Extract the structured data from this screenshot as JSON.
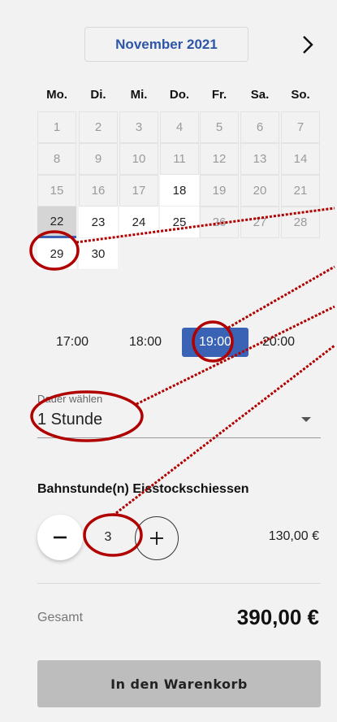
{
  "calendar": {
    "month_label": "November 2021",
    "next_icon": "chevron-right-icon",
    "weekdays": [
      "Mo.",
      "Di.",
      "Mi.",
      "Do.",
      "Fr.",
      "Sa.",
      "So."
    ],
    "weeks": [
      [
        {
          "d": "1",
          "s": "past"
        },
        {
          "d": "2",
          "s": "past"
        },
        {
          "d": "3",
          "s": "past"
        },
        {
          "d": "4",
          "s": "past"
        },
        {
          "d": "5",
          "s": "past"
        },
        {
          "d": "6",
          "s": "past"
        },
        {
          "d": "7",
          "s": "past"
        }
      ],
      [
        {
          "d": "8",
          "s": "past"
        },
        {
          "d": "9",
          "s": "past"
        },
        {
          "d": "10",
          "s": "past"
        },
        {
          "d": "11",
          "s": "past"
        },
        {
          "d": "12",
          "s": "past"
        },
        {
          "d": "13",
          "s": "past"
        },
        {
          "d": "14",
          "s": "past"
        }
      ],
      [
        {
          "d": "15",
          "s": "past"
        },
        {
          "d": "16",
          "s": "past"
        },
        {
          "d": "17",
          "s": "past"
        },
        {
          "d": "18",
          "s": "avail"
        },
        {
          "d": "19",
          "s": "past"
        },
        {
          "d": "20",
          "s": "past"
        },
        {
          "d": "21",
          "s": "past"
        }
      ],
      [
        {
          "d": "22",
          "s": "sel"
        },
        {
          "d": "23",
          "s": "avail"
        },
        {
          "d": "24",
          "s": "avail"
        },
        {
          "d": "25",
          "s": "avail"
        },
        {
          "d": "26",
          "s": "past"
        },
        {
          "d": "27",
          "s": "past"
        },
        {
          "d": "28",
          "s": "past"
        }
      ],
      [
        {
          "d": "29",
          "s": "avail"
        },
        {
          "d": "30",
          "s": "avail"
        }
      ]
    ]
  },
  "time_slots": [
    {
      "label": "17:00",
      "active": false
    },
    {
      "label": "18:00",
      "active": false
    },
    {
      "label": "19:00",
      "active": true
    },
    {
      "label": "20:00",
      "active": false
    }
  ],
  "duration": {
    "label": "Dauer wählen",
    "value": "1 Stunde"
  },
  "product": {
    "title": "Bahnstunde(n) Eisstockschiessen",
    "quantity": "3",
    "unit_price": "130,00 €"
  },
  "total": {
    "label": "Gesamt",
    "value": "390,00 €"
  },
  "cart_button": "In den Warenkorb",
  "colors": {
    "accent": "#3a63b5",
    "annotation": "#b00000",
    "background": "#f2f2f2"
  }
}
